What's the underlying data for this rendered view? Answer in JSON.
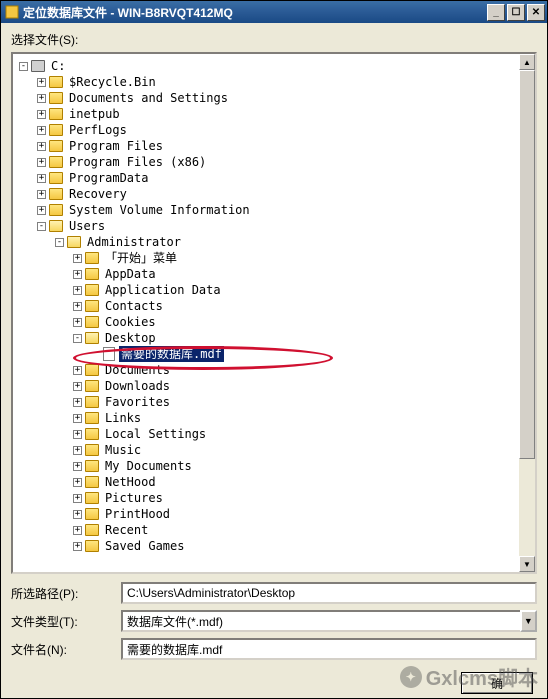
{
  "window": {
    "title": "定位数据库文件 - WIN-B8RVQT412MQ"
  },
  "labels": {
    "select_file": "选择文件(S):",
    "selected_path": "所选路径(P):",
    "file_type": "文件类型(T):",
    "file_name": "文件名(N):"
  },
  "tree": [
    {
      "depth": 0,
      "toggle": "-",
      "icon": "drive",
      "label": "C:"
    },
    {
      "depth": 1,
      "toggle": "+",
      "icon": "folder",
      "label": "$Recycle.Bin"
    },
    {
      "depth": 1,
      "toggle": "+",
      "icon": "folder",
      "label": "Documents and Settings"
    },
    {
      "depth": 1,
      "toggle": "+",
      "icon": "folder",
      "label": "inetpub"
    },
    {
      "depth": 1,
      "toggle": "+",
      "icon": "folder",
      "label": "PerfLogs"
    },
    {
      "depth": 1,
      "toggle": "+",
      "icon": "folder",
      "label": "Program Files"
    },
    {
      "depth": 1,
      "toggle": "+",
      "icon": "folder",
      "label": "Program Files (x86)"
    },
    {
      "depth": 1,
      "toggle": "+",
      "icon": "folder",
      "label": "ProgramData"
    },
    {
      "depth": 1,
      "toggle": "+",
      "icon": "folder",
      "label": "Recovery"
    },
    {
      "depth": 1,
      "toggle": "+",
      "icon": "folder",
      "label": "System Volume Information"
    },
    {
      "depth": 1,
      "toggle": "-",
      "icon": "folder-open",
      "label": "Users"
    },
    {
      "depth": 2,
      "toggle": "-",
      "icon": "folder-open",
      "label": "Administrator"
    },
    {
      "depth": 3,
      "toggle": "+",
      "icon": "folder",
      "label": "「开始」菜单"
    },
    {
      "depth": 3,
      "toggle": "+",
      "icon": "folder",
      "label": "AppData"
    },
    {
      "depth": 3,
      "toggle": "+",
      "icon": "folder",
      "label": "Application Data"
    },
    {
      "depth": 3,
      "toggle": "+",
      "icon": "folder",
      "label": "Contacts"
    },
    {
      "depth": 3,
      "toggle": "+",
      "icon": "folder",
      "label": "Cookies"
    },
    {
      "depth": 3,
      "toggle": "-",
      "icon": "folder-open",
      "label": "Desktop"
    },
    {
      "depth": 4,
      "toggle": "",
      "icon": "file",
      "label": "需要的数据库.mdf",
      "selected": true
    },
    {
      "depth": 3,
      "toggle": "+",
      "icon": "folder",
      "label": "Documents"
    },
    {
      "depth": 3,
      "toggle": "+",
      "icon": "folder",
      "label": "Downloads"
    },
    {
      "depth": 3,
      "toggle": "+",
      "icon": "folder",
      "label": "Favorites"
    },
    {
      "depth": 3,
      "toggle": "+",
      "icon": "folder",
      "label": "Links"
    },
    {
      "depth": 3,
      "toggle": "+",
      "icon": "folder",
      "label": "Local Settings"
    },
    {
      "depth": 3,
      "toggle": "+",
      "icon": "folder",
      "label": "Music"
    },
    {
      "depth": 3,
      "toggle": "+",
      "icon": "folder",
      "label": "My Documents"
    },
    {
      "depth": 3,
      "toggle": "+",
      "icon": "folder",
      "label": "NetHood"
    },
    {
      "depth": 3,
      "toggle": "+",
      "icon": "folder",
      "label": "Pictures"
    },
    {
      "depth": 3,
      "toggle": "+",
      "icon": "folder",
      "label": "PrintHood"
    },
    {
      "depth": 3,
      "toggle": "+",
      "icon": "folder",
      "label": "Recent"
    },
    {
      "depth": 3,
      "toggle": "+",
      "icon": "folder",
      "label": "Saved Games"
    }
  ],
  "form": {
    "path_value": "C:\\Users\\Administrator\\Desktop",
    "file_type_value": "数据库文件(*.mdf)",
    "file_name_value": "需要的数据库.mdf"
  },
  "buttons": {
    "ok": "确",
    "cancel": ""
  },
  "watermark": "Gxlcms脚本"
}
